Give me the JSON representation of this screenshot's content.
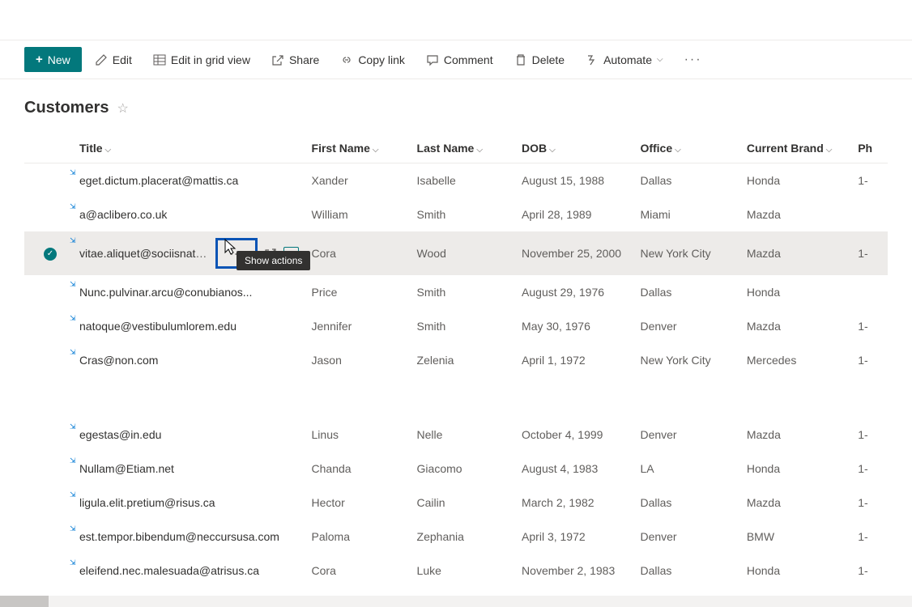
{
  "commandBar": {
    "new": "New",
    "edit": "Edit",
    "editGrid": "Edit in grid view",
    "share": "Share",
    "copyLink": "Copy link",
    "comment": "Comment",
    "delete": "Delete",
    "automate": "Automate"
  },
  "listTitle": "Customers",
  "columns": {
    "title": "Title",
    "firstName": "First Name",
    "lastName": "Last Name",
    "dob": "DOB",
    "office": "Office",
    "brand": "Current Brand",
    "phone": "Ph"
  },
  "tooltip": "Show actions",
  "rows": [
    {
      "title": "eget.dictum.placerat@mattis.ca",
      "first": "Xander",
      "last": "Isabelle",
      "dob": "August 15, 1988",
      "office": "Dallas",
      "brand": "Honda",
      "phone": "1-"
    },
    {
      "title": "a@aclibero.co.uk",
      "first": "William",
      "last": "Smith",
      "dob": "April 28, 1989",
      "office": "Miami",
      "brand": "Mazda",
      "phone": ""
    },
    {
      "title": "vitae.aliquet@sociisnato...",
      "first": "Cora",
      "last": "Wood",
      "dob": "November 25, 2000",
      "office": "New York City",
      "brand": "Mazda",
      "phone": "1-",
      "selected": true
    },
    {
      "title": "Nunc.pulvinar.arcu@conubianos...",
      "first": "Price",
      "last": "Smith",
      "dob": "August 29, 1976",
      "office": "Dallas",
      "brand": "Honda",
      "phone": ""
    },
    {
      "title": "natoque@vestibulumlorem.edu",
      "first": "Jennifer",
      "last": "Smith",
      "dob": "May 30, 1976",
      "office": "Denver",
      "brand": "Mazda",
      "phone": "1-"
    },
    {
      "title": "Cras@non.com",
      "first": "Jason",
      "last": "Zelenia",
      "dob": "April 1, 1972",
      "office": "New York City",
      "brand": "Mercedes",
      "phone": "1-"
    }
  ],
  "rows2": [
    {
      "title": "egestas@in.edu",
      "first": "Linus",
      "last": "Nelle",
      "dob": "October 4, 1999",
      "office": "Denver",
      "brand": "Mazda",
      "phone": "1-"
    },
    {
      "title": "Nullam@Etiam.net",
      "first": "Chanda",
      "last": "Giacomo",
      "dob": "August 4, 1983",
      "office": "LA",
      "brand": "Honda",
      "phone": "1-"
    },
    {
      "title": "ligula.elit.pretium@risus.ca",
      "first": "Hector",
      "last": "Cailin",
      "dob": "March 2, 1982",
      "office": "Dallas",
      "brand": "Mazda",
      "phone": "1-"
    },
    {
      "title": "est.tempor.bibendum@neccursusa.com",
      "first": "Paloma",
      "last": "Zephania",
      "dob": "April 3, 1972",
      "office": "Denver",
      "brand": "BMW",
      "phone": "1-"
    },
    {
      "title": "eleifend.nec.malesuada@atrisus.ca",
      "first": "Cora",
      "last": "Luke",
      "dob": "November 2, 1983",
      "office": "Dallas",
      "brand": "Honda",
      "phone": "1-"
    }
  ]
}
